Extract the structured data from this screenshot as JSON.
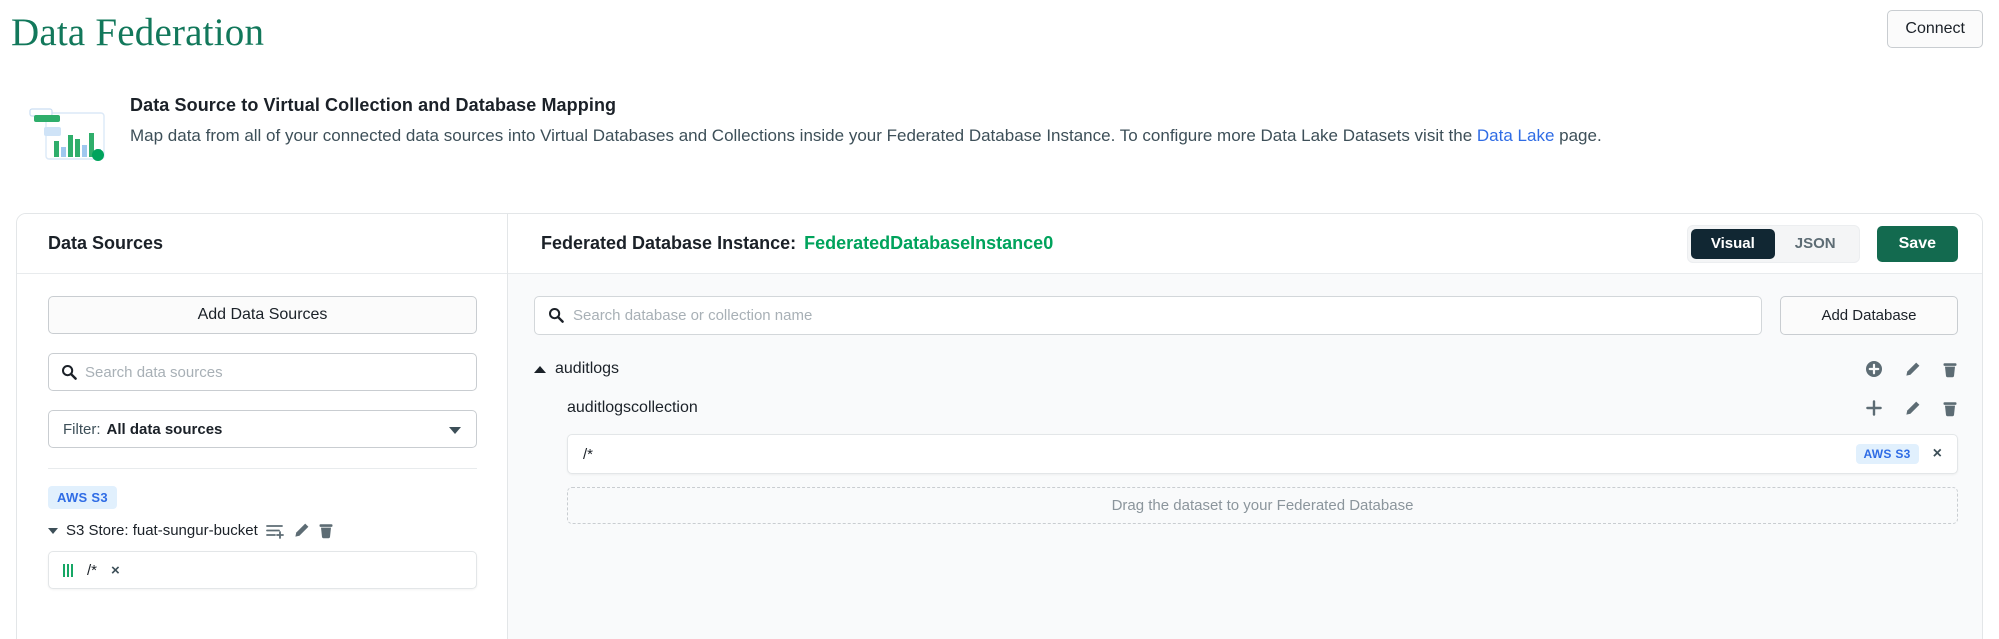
{
  "topbar": {
    "title": "Data Federation",
    "connect_label": "Connect"
  },
  "banner": {
    "icon": "data-chart-icon",
    "title": "Data Source to Virtual Collection and Database Mapping",
    "description_before": "Map data from all of your connected data sources into Virtual Databases and Collections inside your Federated Database Instance. To configure more Data Lake Datasets visit the ",
    "link_label": "Data Lake",
    "description_after": " page."
  },
  "left_panel": {
    "heading": "Data Sources",
    "add_data_sources_label": "Add Data Sources",
    "search": {
      "placeholder": "Search data sources",
      "value": "",
      "icon": "search-icon"
    },
    "filter": {
      "label": "Filter:",
      "value": "All data sources",
      "icon": "chevron-down-icon"
    },
    "groups": [
      {
        "badge": "AWS S3",
        "store_label": "S3 Store: fuat-sungur-bucket",
        "actions": [
          "add-lines-icon",
          "pencil-icon",
          "trash-icon"
        ],
        "datasets": [
          {
            "path": "/*",
            "handle": "drag-handle-icon",
            "remove": "×"
          }
        ]
      }
    ]
  },
  "right_panel": {
    "fdi_label": "Federated Database Instance:",
    "fdi_value": "FederatedDatabaseInstance0",
    "view_modes": [
      {
        "label": "Visual",
        "active": true
      },
      {
        "label": "JSON",
        "active": false
      }
    ],
    "save_label": "Save",
    "search": {
      "placeholder": "Search database or collection name",
      "value": "",
      "icon": "search-icon"
    },
    "add_database_label": "Add Database",
    "databases": [
      {
        "name": "auditlogs",
        "expanded": true,
        "caret": "caret-up-icon",
        "actions": [
          "add-circle-icon",
          "pencil-icon",
          "trash-icon"
        ],
        "collections": [
          {
            "name": "auditlogscollection",
            "actions": [
              "plus-icon",
              "pencil-icon",
              "trash-icon"
            ],
            "datasets": [
              {
                "path": "/*",
                "badge": "AWS S3",
                "remove": "×"
              }
            ],
            "dropzone_text": "Drag the dataset to your Federated Database"
          }
        ]
      }
    ]
  },
  "colors": {
    "brand_green": "#12785b",
    "accent_green": "#00a35c",
    "save_green": "#136a4f",
    "link_blue": "#2f6ce5",
    "badge_bg": "#e1f0fd",
    "dark_navy": "#112733",
    "grip_green": "#16a765"
  }
}
